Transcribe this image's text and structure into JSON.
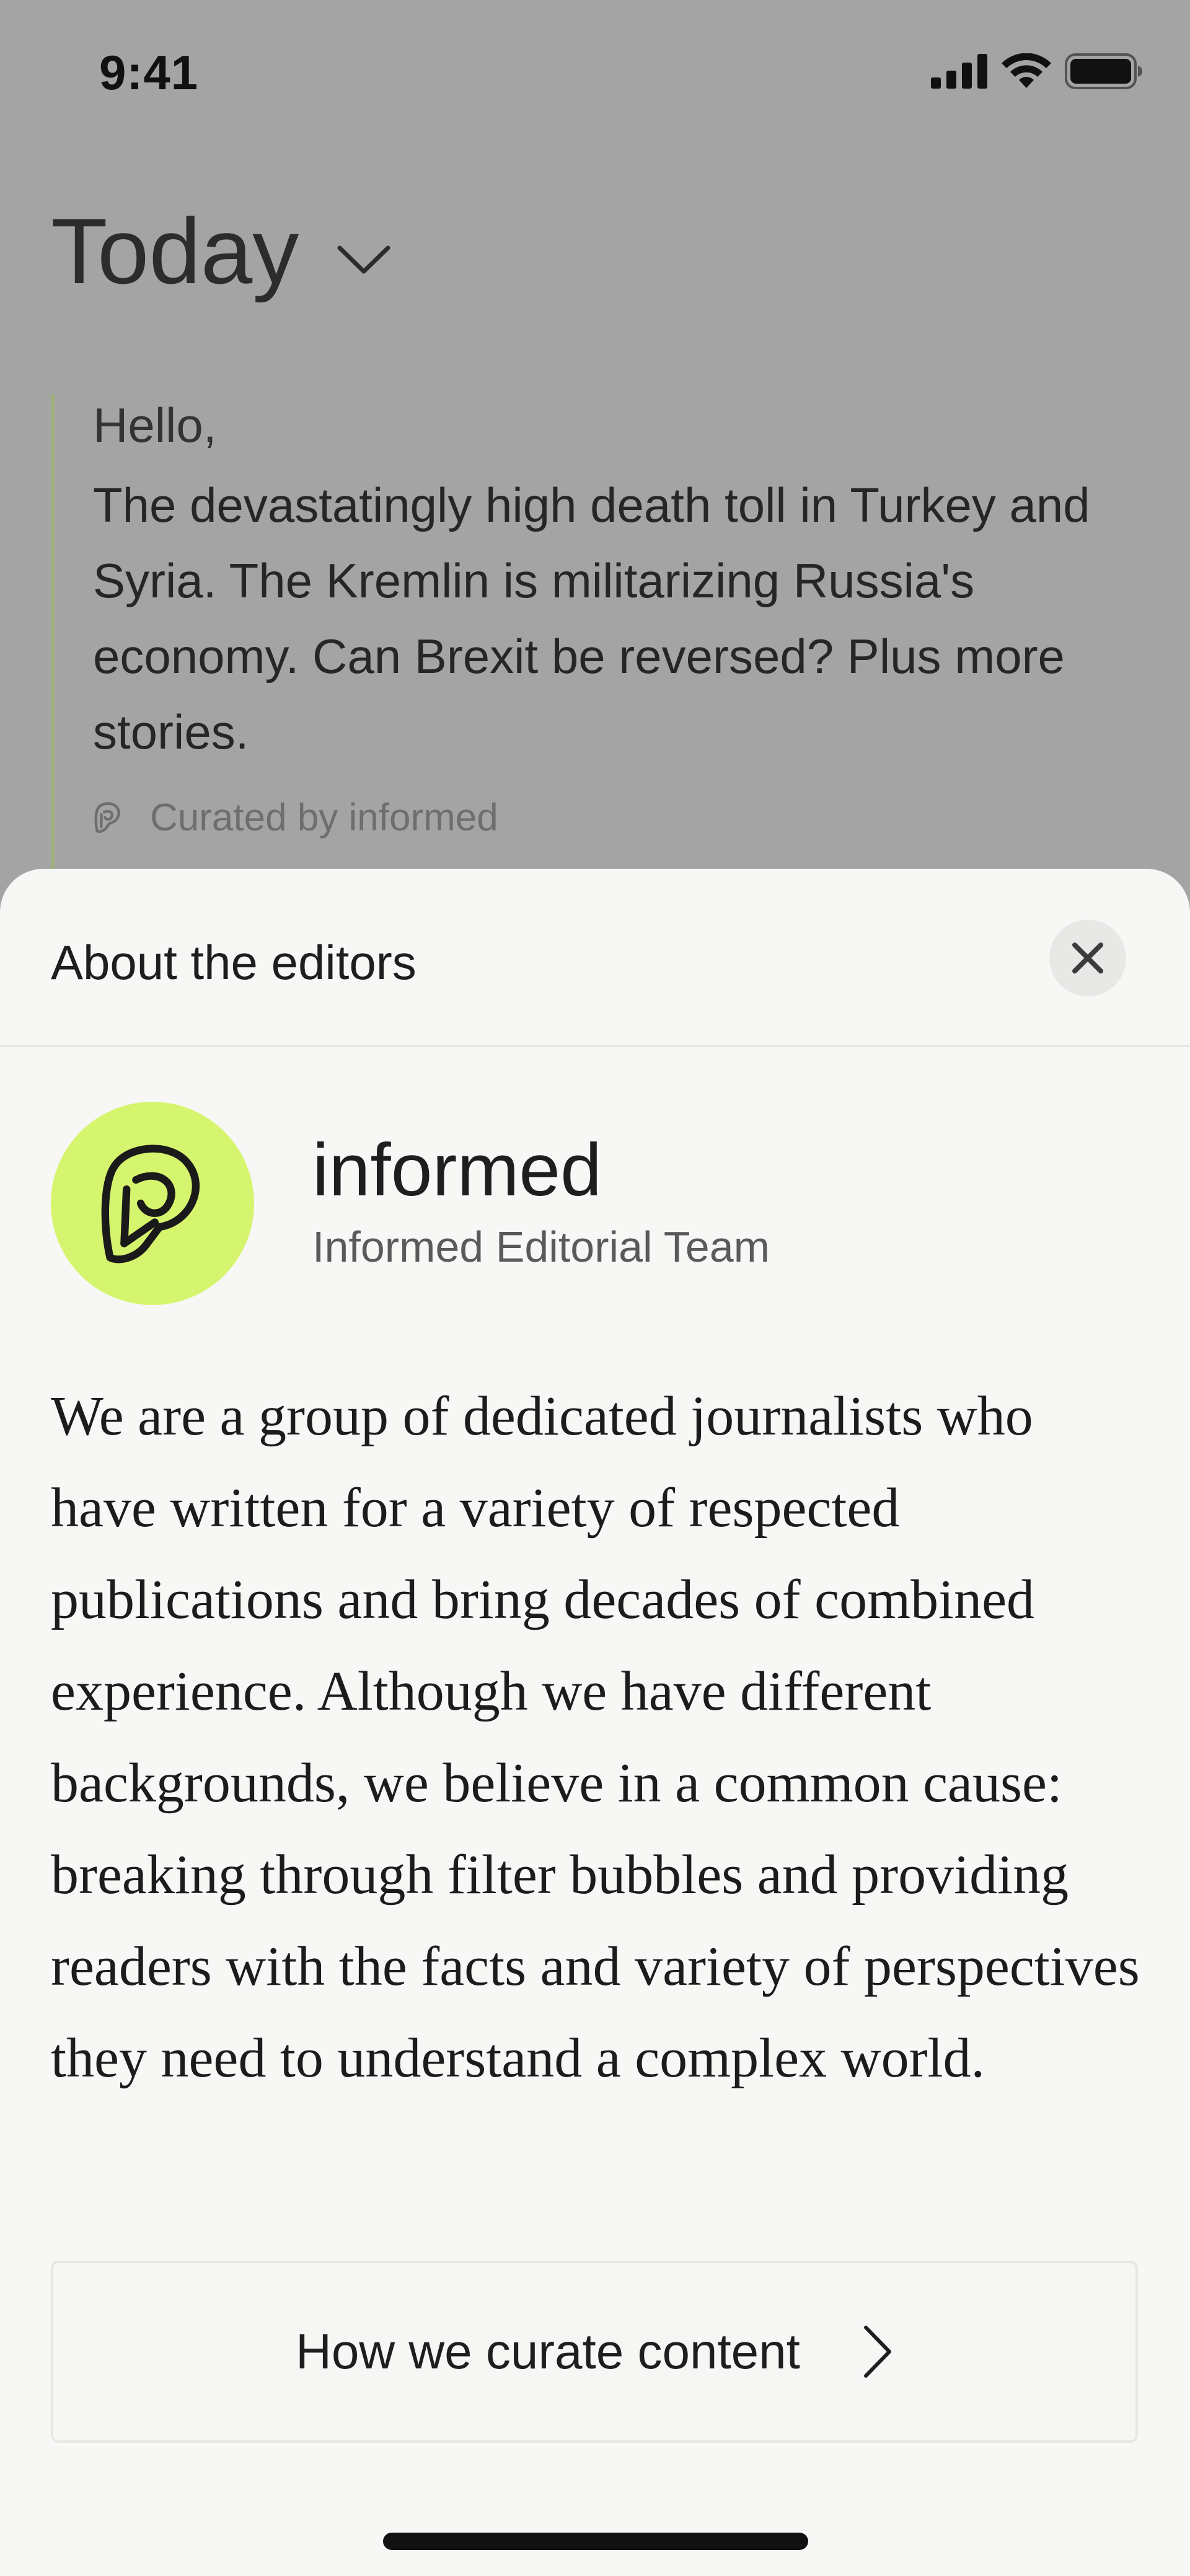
{
  "status_bar": {
    "time": "9:41",
    "icons": [
      "cellular-signal-icon",
      "wifi-icon",
      "battery-icon"
    ]
  },
  "background": {
    "title": "Today",
    "title_icon": "chevron-down-icon",
    "digest": {
      "greeting": "Hello,",
      "summary": "The devastatingly high death toll in Turkey and Syria. The Kremlin is militarizing Russia's economy. Can Brexit be reversed? Plus more stories.",
      "credit": "Curated by informed",
      "credit_icon": "informed-logo-icon"
    }
  },
  "sheet": {
    "title": "About the editors",
    "close_icon": "close-icon",
    "editor": {
      "name": "informed",
      "team": "Informed Editorial Team",
      "avatar_icon": "informed-logo-icon",
      "avatar_color": "#d6f56e"
    },
    "about": "We are a group of dedicated journalists who have written for a variety of respected publications and bring decades of combined experience. Although we have different backgrounds, we believe in a common cause: breaking through filter bubbles and providing readers with the facts and variety of perspectives they need to understand a complex world.",
    "curate_button": {
      "label": "How we curate content",
      "icon": "chevron-right-icon"
    }
  },
  "colors": {
    "scrim": "#a4a4a4",
    "sheet_background": "#f7f7f6",
    "accent": "#d6f56e",
    "digest_rule": "#9fb07e"
  }
}
